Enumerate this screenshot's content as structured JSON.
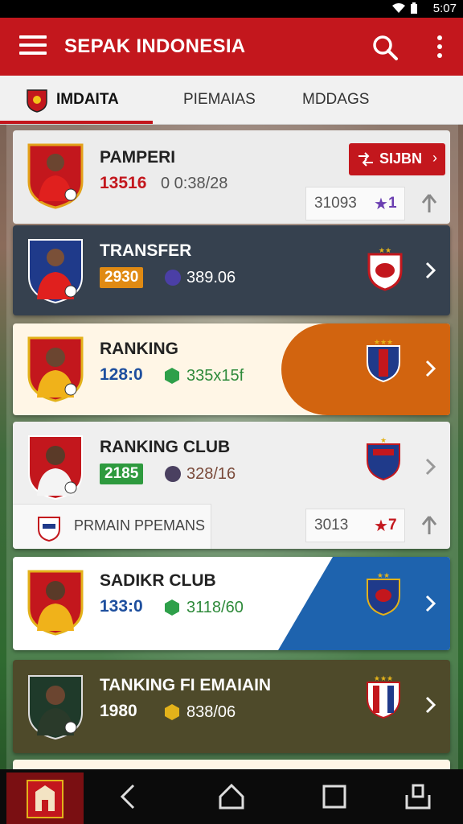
{
  "status_bar": {
    "time": "5:07"
  },
  "app_bar": {
    "title": "SEPAK INDONESIA"
  },
  "tabs": [
    {
      "label": "IMDAITA",
      "active": true
    },
    {
      "label": "PIEMAIAS",
      "active": false
    },
    {
      "label": "MDDAGS",
      "active": false
    }
  ],
  "cards": [
    {
      "name": "PAMPERI",
      "number": "13516",
      "meta": "0 0:38/28",
      "action_label": "SIJBN",
      "stat_value": "31093",
      "stat_badge": "1"
    },
    {
      "name": "TRANSFER",
      "number": "2930",
      "meta": "389.06"
    },
    {
      "name": "RANKING",
      "number": "128:0",
      "meta": "335x15f"
    },
    {
      "name": "RANKING CLUB",
      "number": "2185",
      "meta": "328/16",
      "sub_label": "PRMAIN PPEMANS",
      "stat_value": "3013",
      "stat_badge": "7"
    },
    {
      "name": "SADIKR CLUB",
      "number": "133:0",
      "meta": "3118/60"
    },
    {
      "name": "TANKING FI EMAIAIN",
      "number": "1980",
      "meta": "838/06"
    }
  ],
  "colors": {
    "primary": "#c3171d",
    "orange": "#d2640f",
    "blue": "#1e63ae",
    "navy": "#36414f",
    "olive": "#4e4a2a"
  }
}
